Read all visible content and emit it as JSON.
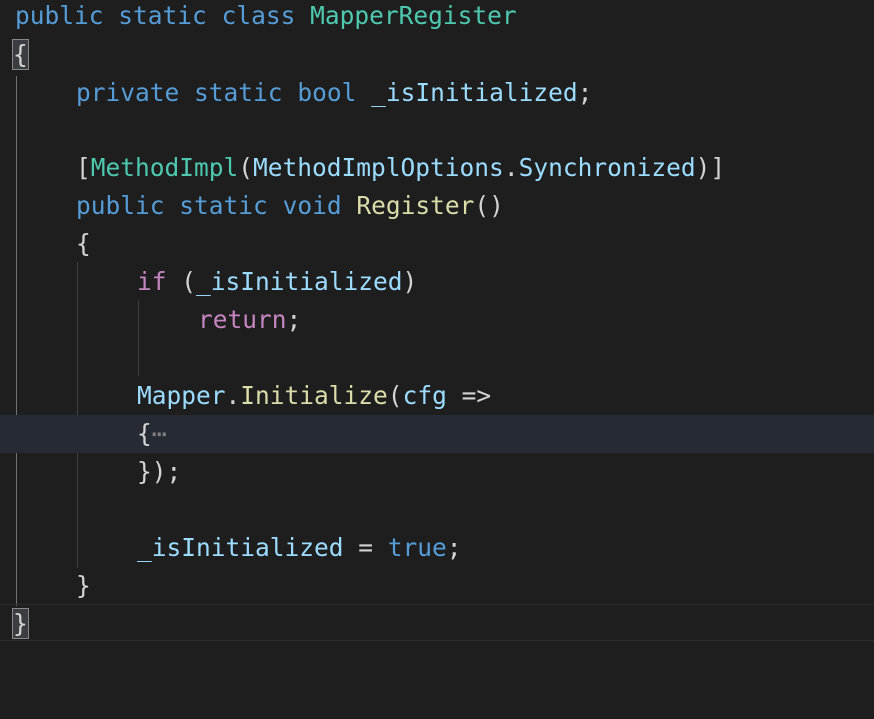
{
  "lines": {
    "l1": {
      "kw1": "public",
      "kw2": "static",
      "kw3": "class",
      "name": "MapperRegister"
    },
    "l2": {
      "brace": "{"
    },
    "l3": {
      "kw1": "private",
      "kw2": "static",
      "kw3": "bool",
      "var": "_isInitialized",
      "end": ";"
    },
    "l5": {
      "open": "[",
      "attr": "MethodImpl",
      "paren": "(",
      "enum": "MethodImplOptions",
      "dot": ".",
      "member": "Synchronized",
      "close": ")]"
    },
    "l6": {
      "kw1": "public",
      "kw2": "static",
      "kw3": "void",
      "method": "Register",
      "parens": "()"
    },
    "l7": {
      "brace": "{"
    },
    "l8": {
      "kw": "if",
      "open": " (",
      "var": "_isInitialized",
      "close": ")"
    },
    "l9": {
      "kw": "return",
      "end": ";"
    },
    "l11": {
      "obj": "Mapper",
      "dot": ".",
      "method": "Initialize",
      "open": "(",
      "param": "cfg",
      "arrow": " =>"
    },
    "l12": {
      "brace": "{",
      "fold": "⋯"
    },
    "l13": {
      "close": "});"
    },
    "l15": {
      "var": "_isInitialized",
      "eq": " = ",
      "val": "true",
      "end": ";"
    },
    "l16": {
      "brace": "}"
    },
    "l17": {
      "brace": "}"
    }
  }
}
